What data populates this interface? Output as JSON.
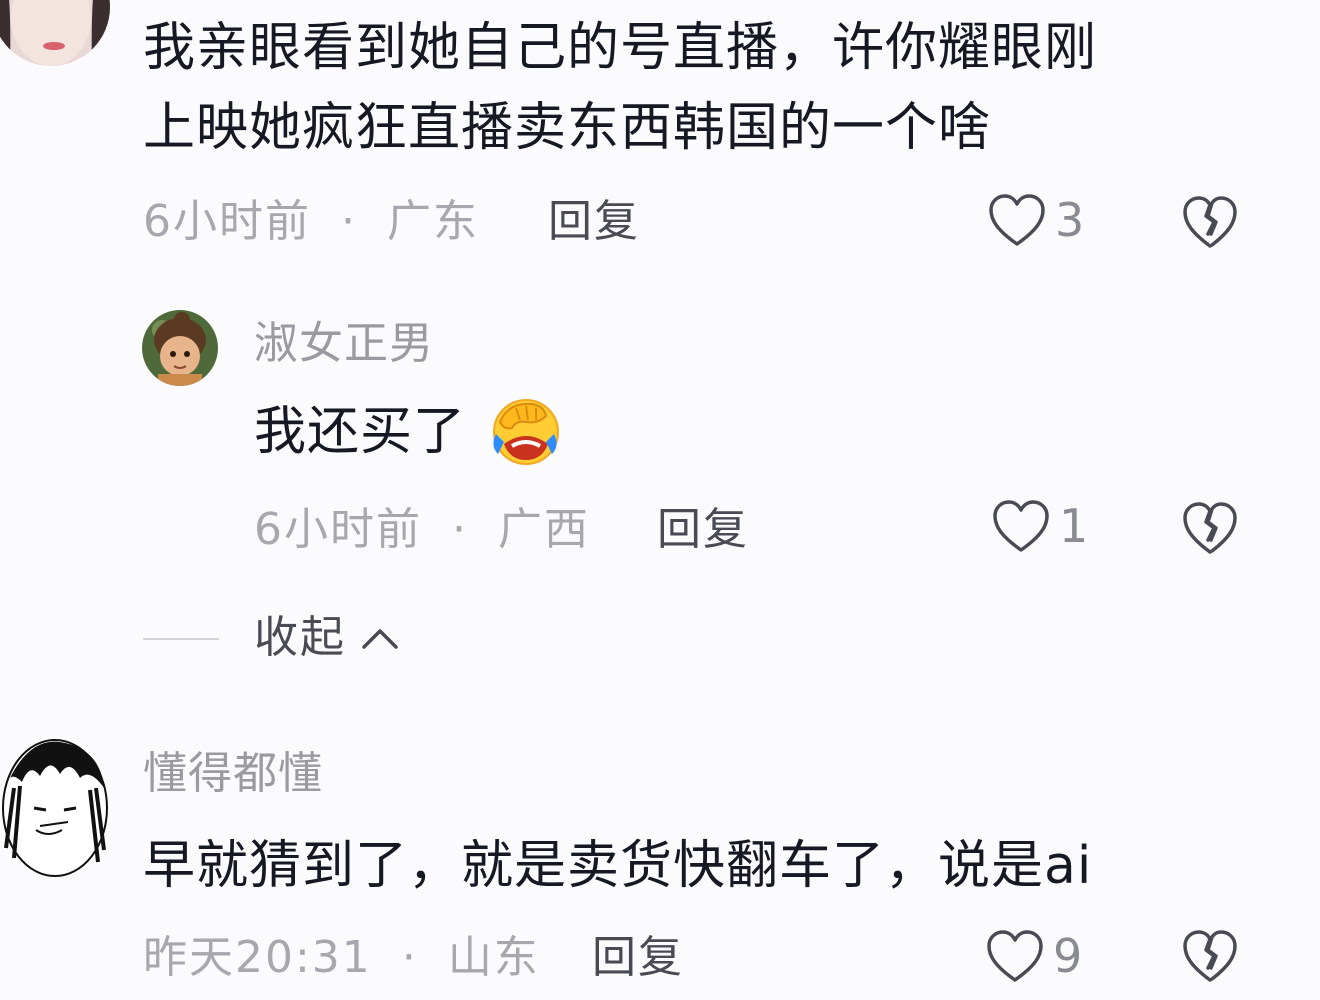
{
  "comments": [
    {
      "content_lines": [
        "我亲眼看到她自己的号直播，许你耀眼刚",
        "上映她疯狂直播卖东西韩国的一个啥"
      ],
      "time": "6小时前",
      "location": "广东",
      "reply_label": "回复",
      "like_count": "3"
    },
    {
      "username": "淑女正男",
      "content": "我还买了",
      "emoji": "facepalm-crying-emoji",
      "time": "6小时前",
      "location": "广西",
      "reply_label": "回复",
      "like_count": "1"
    },
    {
      "username": "懂得都懂",
      "content": "早就猜到了，就是卖货快翻车了，说是ai",
      "time": "昨天20:31",
      "location": "山东",
      "reply_label": "回复",
      "like_count": "9"
    }
  ],
  "collapse_label": "收起",
  "separator": "·",
  "icons": {
    "like": "heart-outline-icon",
    "dislike": "broken-heart-icon",
    "collapse": "chevron-up-icon"
  },
  "colors": {
    "background": "#fbfbfd",
    "text_primary": "#161823",
    "text_secondary": "#a7a7ad",
    "icon": "#4a4a55"
  }
}
